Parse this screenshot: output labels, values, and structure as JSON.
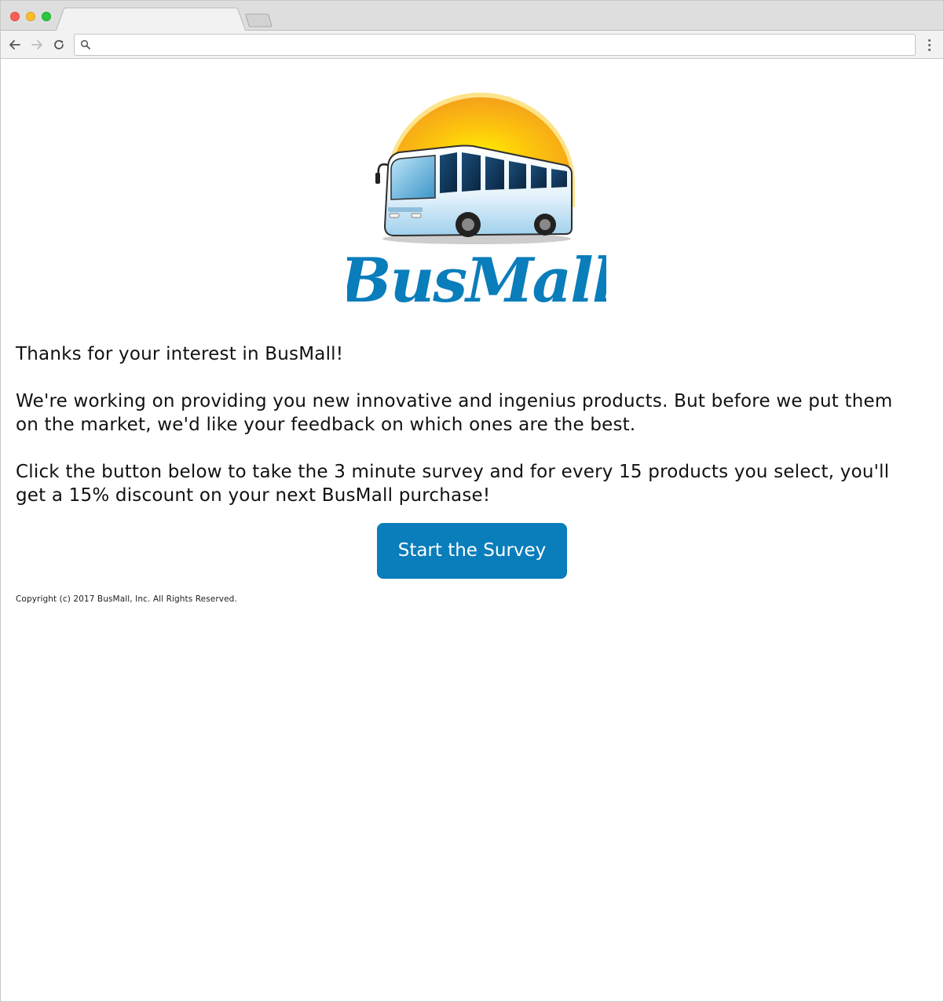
{
  "browser": {
    "tab_title": "",
    "address": {
      "value": "",
      "placeholder": ""
    }
  },
  "logo": {
    "text": "BusMall"
  },
  "content": {
    "intro": "Thanks for your interest in BusMall!",
    "paragraph_1": "We're working on providing you new innovative and ingenius products. But before we put them on the market, we'd like your feedback on which ones are the best.",
    "paragraph_2": "Click the button below to take the 3 minute survey and for every 15 products you select, you'll get a 15% discount on your next BusMall purchase!"
  },
  "cta": {
    "label": "Start the Survey"
  },
  "footer": {
    "copyright": "Copyright (c) 2017 BusMall, Inc. All Rights Reserved."
  },
  "colors": {
    "brand_blue": "#0a7dbb",
    "sun_orange": "#f8a51c",
    "sun_yellow": "#fde300"
  },
  "icons": {
    "back": "arrow-left-icon",
    "forward": "arrow-right-icon",
    "reload": "reload-icon",
    "search": "search-icon",
    "menu": "kebab-menu-icon"
  }
}
